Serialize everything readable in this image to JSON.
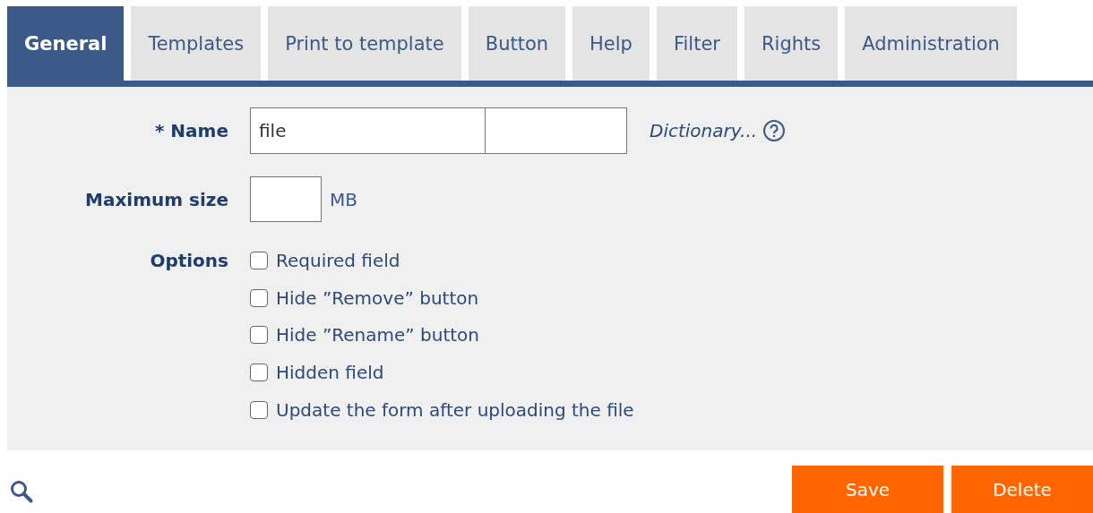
{
  "tabs": [
    {
      "label": "General",
      "selected": true
    },
    {
      "label": "Templates",
      "selected": false
    },
    {
      "label": "Print to template",
      "selected": false
    },
    {
      "label": "Button",
      "selected": false
    },
    {
      "label": "Help",
      "selected": false
    },
    {
      "label": "Filter",
      "selected": false
    },
    {
      "label": "Rights",
      "selected": false
    },
    {
      "label": "Administration",
      "selected": false
    }
  ],
  "name_field": {
    "label": "* Name",
    "value": "file",
    "link": "Dictionary..."
  },
  "max_size": {
    "label": "Maximum size",
    "unit": "MB"
  },
  "options": {
    "label": "Options",
    "items": [
      {
        "label": "Required field",
        "checked": false
      },
      {
        "label": "Hide ”Remove” button",
        "checked": false
      },
      {
        "label": "Hide ”Rename” button",
        "checked": false
      },
      {
        "label": "Hidden field",
        "checked": false
      },
      {
        "label": "Update the form after uploading the file",
        "checked": false
      }
    ]
  },
  "buttons": [
    "Save",
    "Delete"
  ]
}
